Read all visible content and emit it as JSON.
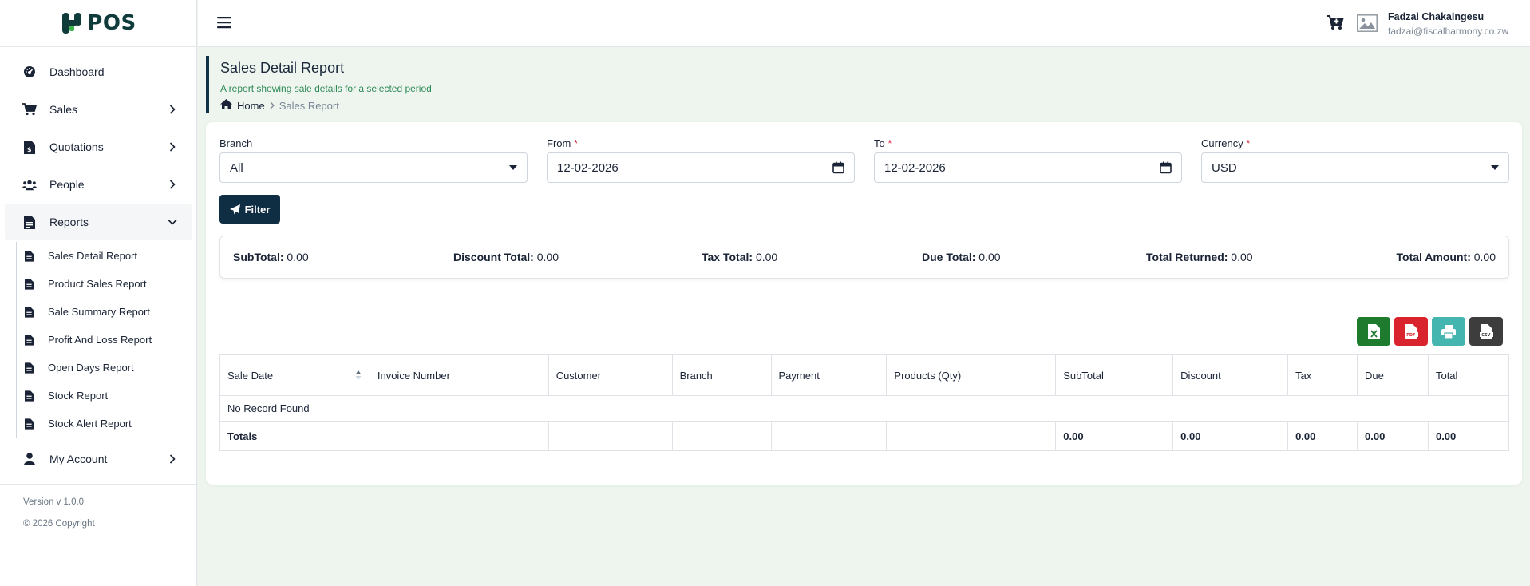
{
  "app": {
    "logo_text": "POS"
  },
  "sidebar": {
    "items": [
      {
        "label": "Dashboard"
      },
      {
        "label": "Sales"
      },
      {
        "label": "Quotations"
      },
      {
        "label": "People"
      },
      {
        "label": "Reports"
      },
      {
        "label": "My Account"
      }
    ],
    "reports_submenu": [
      {
        "label": "Sales Detail Report"
      },
      {
        "label": "Product Sales Report"
      },
      {
        "label": "Sale Summary Report"
      },
      {
        "label": "Profit And Loss Report"
      },
      {
        "label": "Open Days Report"
      },
      {
        "label": "Stock Report"
      },
      {
        "label": "Stock Alert Report"
      }
    ],
    "version": "Version v 1.0.0",
    "copyright": "© 2026 Copyright"
  },
  "header": {
    "user_name": "Fadzai Chakaingesu",
    "user_email": "fadzai@fiscalharmony.co.zw"
  },
  "page": {
    "title": "Sales Detail Report",
    "subtitle": "A report showing sale details for a selected period",
    "breadcrumb_home": "Home",
    "breadcrumb_current": "Sales Report"
  },
  "filters": {
    "branch_label": "Branch",
    "branch_value": "All",
    "from_label": "From",
    "from_value": "12-02-2026",
    "to_label": "To",
    "to_value": "12-02-2026",
    "currency_label": "Currency",
    "currency_value": "USD",
    "required_mark": "*",
    "filter_button": "Filter"
  },
  "summary": {
    "subtotal_label": "SubTotal:",
    "subtotal_value": "0.00",
    "discount_label": "Discount Total:",
    "discount_value": "0.00",
    "tax_label": "Tax Total:",
    "tax_value": "0.00",
    "due_label": "Due Total:",
    "due_value": "0.00",
    "returned_label": "Total Returned:",
    "returned_value": "0.00",
    "amount_label": "Total Amount:",
    "amount_value": "0.00"
  },
  "table": {
    "columns": [
      "Sale Date",
      "Invoice Number",
      "Customer",
      "Branch",
      "Payment",
      "Products (Qty)",
      "SubTotal",
      "Discount",
      "Tax",
      "Due",
      "Total"
    ],
    "empty_message": "No Record Found",
    "totals_label": "Totals",
    "totals": {
      "subtotal": "0.00",
      "discount": "0.00",
      "tax": "0.00",
      "due": "0.00",
      "total": "0.00"
    }
  },
  "colors": {
    "primary": "#0f2d43",
    "excel": "#1e7b2e",
    "pdf": "#d9232d",
    "print": "#45b5b0",
    "csv": "#3d3d3d",
    "subtitle_green": "#2e8a55",
    "background": "#eef5ef"
  }
}
